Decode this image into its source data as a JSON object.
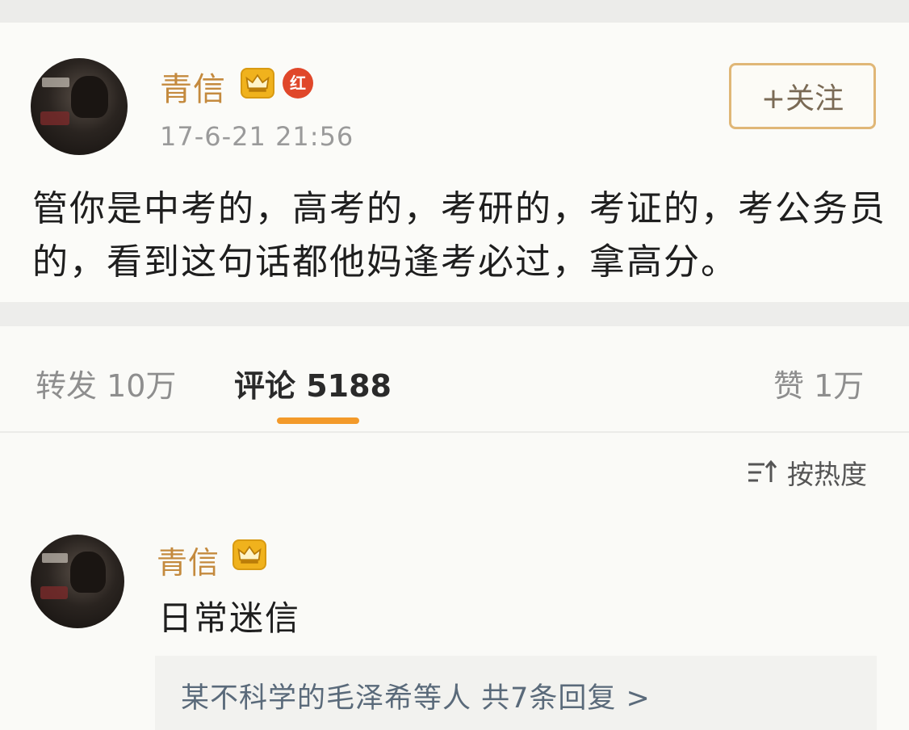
{
  "post": {
    "author": "青信",
    "vip_badge_icon": "crown-icon",
    "red_badge_label": "红",
    "timestamp": "17-6-21 21:56",
    "follow_label": "+关注",
    "text": "管你是中考的，高考的，考研的，考证的，考公务员的，看到这句话都他妈逢考必过，拿高分。"
  },
  "stats": {
    "repost": "转发 10万",
    "comments": "评论 5188",
    "likes": "赞 1万"
  },
  "sort": {
    "icon": "sort-icon",
    "label": "按热度"
  },
  "comment": {
    "author": "青信",
    "vip_badge_icon": "crown-icon",
    "text": "日常迷信",
    "replies": "某不科学的毛泽希等人  共7条回复 >"
  },
  "colors": {
    "username": "#c48a3e",
    "accent_underline": "#f39a2a",
    "follow_border": "#e0b777",
    "vip_gold": "#f0b21d",
    "red_badge": "#e0472a"
  }
}
